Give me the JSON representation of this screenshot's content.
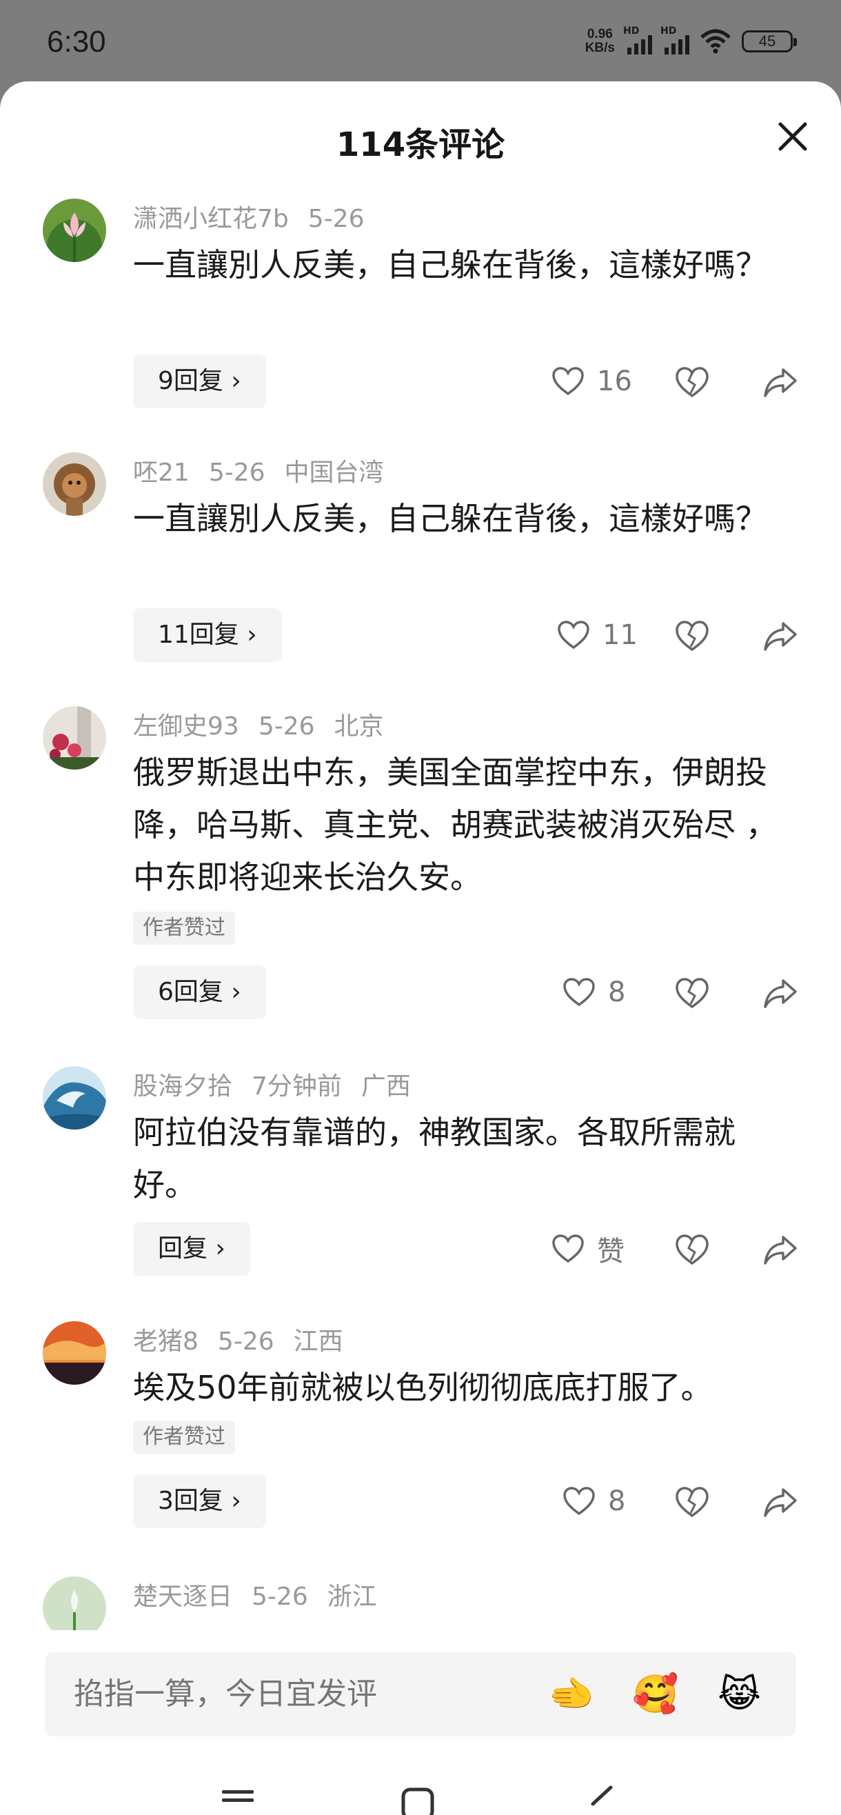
{
  "status": {
    "time": "6:30",
    "speed_value": "0.96",
    "speed_unit": "KB/s",
    "signal1_label": "HD",
    "signal2_label": "HD",
    "battery": "45"
  },
  "header": {
    "title": "114条评论"
  },
  "comments": [
    {
      "user": "潇洒小红花7b",
      "date": "5-26",
      "region": "",
      "text": "一直讓別人反美，自己躲在背後，這樣好嗎？",
      "badge": "",
      "reply": "9回复 ›",
      "likes": "16"
    },
    {
      "user": "呸21",
      "date": "5-26",
      "region": "中国台湾",
      "text": "一直讓別人反美，自己躲在背後，這樣好嗎？",
      "badge": "",
      "reply": "11回复 ›",
      "likes": "11"
    },
    {
      "user": "左御史93",
      "date": "5-26",
      "region": "北京",
      "text": "俄罗斯退出中东，美国全面掌控中东，伊朗投降，哈马斯、真主党、胡赛武装被消灭殆尽 ， 中东即将迎来长治久安。",
      "badge": "作者赞过",
      "reply": "6回复 ›",
      "likes": "8"
    },
    {
      "user": "股海夕拾",
      "date": "7分钟前",
      "region": "广西",
      "text": "阿拉伯没有靠谱的，神教国家。各取所需就好。",
      "badge": "",
      "reply": "回复 ›",
      "likes": "赞"
    },
    {
      "user": "老猪8",
      "date": "5-26",
      "region": "江西",
      "text": "埃及50年前就被以色列彻彻底底打服了。",
      "badge": "作者赞过",
      "reply": "3回复 ›",
      "likes": "8"
    },
    {
      "user": "楚天逐日",
      "date": "5-26",
      "region": "浙江",
      "text": "",
      "badge": "",
      "reply": "",
      "likes": ""
    }
  ],
  "input": {
    "placeholder": "掐指一算，今日宜发评",
    "emojis": [
      "🫲",
      "🥰",
      "😹"
    ]
  },
  "colors": {
    "accent_text": "#1b1b1b",
    "meta_text": "#999999",
    "overlay": "#7d7d7d"
  }
}
